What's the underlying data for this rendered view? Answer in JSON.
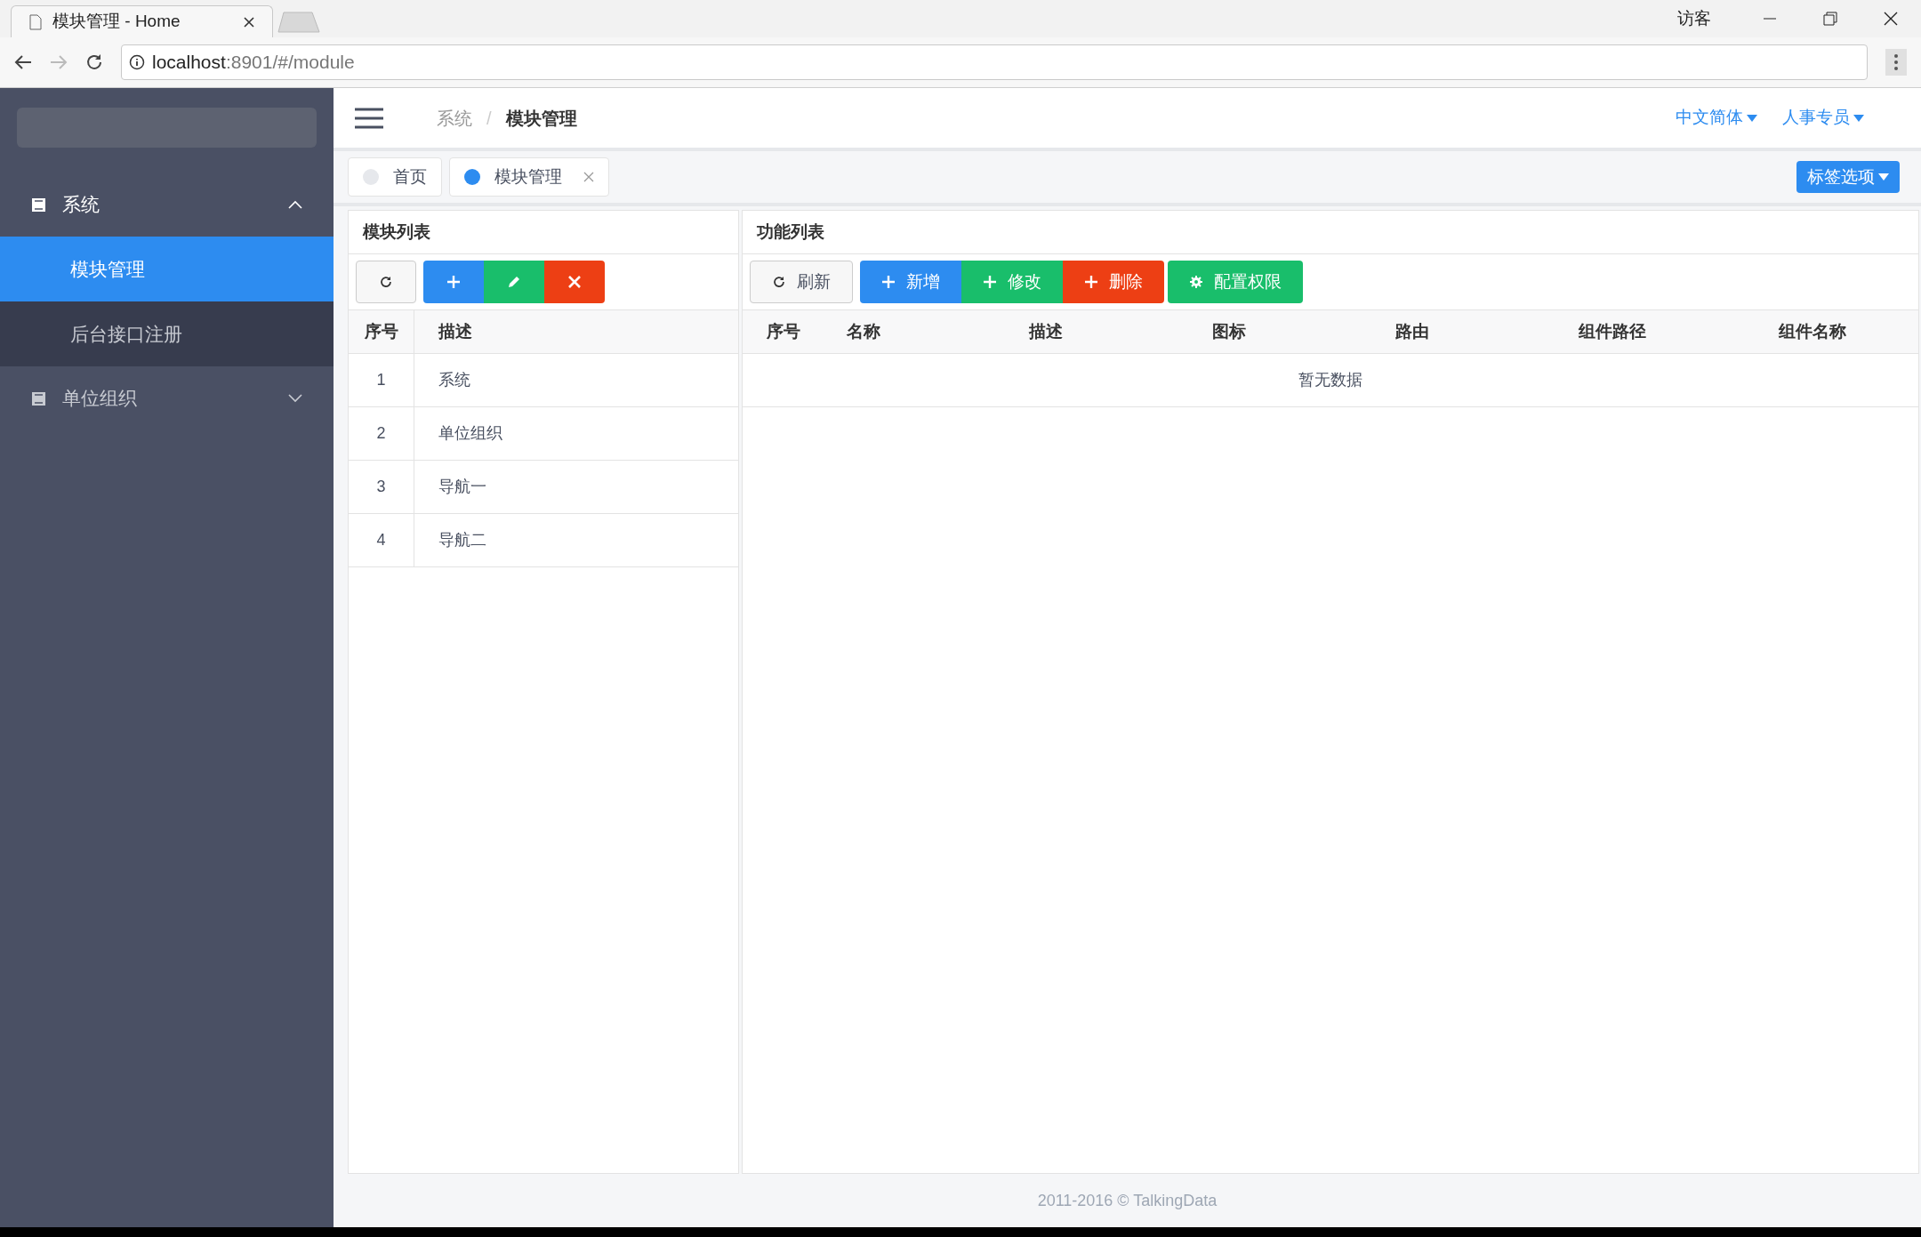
{
  "browser": {
    "tab_title": "模块管理 - Home",
    "url_host": "localhost",
    "url_rest": ":8901/#/module",
    "profile": "访客"
  },
  "sidebar": {
    "items": [
      {
        "label": "系统",
        "expanded": true,
        "children": [
          {
            "label": "模块管理",
            "selected": true
          },
          {
            "label": "后台接口注册",
            "selected": false
          }
        ]
      },
      {
        "label": "单位组织",
        "expanded": false
      }
    ]
  },
  "header": {
    "breadcrumb": [
      "系统",
      "模块管理"
    ],
    "separator": "/",
    "menus": [
      "中文简体",
      "人事专员"
    ]
  },
  "tabs": [
    {
      "label": "首页",
      "selected": false,
      "closable": false
    },
    {
      "label": "模块管理",
      "selected": true,
      "closable": true
    }
  ],
  "tab_options": "标签选项",
  "module_panel": {
    "title": "模块列表",
    "toolbar": [
      {
        "kind": "refresh"
      },
      {
        "kind": "add"
      },
      {
        "kind": "edit"
      },
      {
        "kind": "delete"
      }
    ],
    "columns": [
      "序号",
      "描述"
    ],
    "rows": [
      {
        "index": "1",
        "description": "系统"
      },
      {
        "index": "2",
        "description": "单位组织"
      },
      {
        "index": "3",
        "description": "导航一"
      },
      {
        "index": "4",
        "description": "导航二"
      }
    ]
  },
  "function_panel": {
    "title": "功能列表",
    "toolbar": [
      {
        "kind": "refresh",
        "label": "刷新"
      },
      {
        "kind": "add",
        "label": "新增"
      },
      {
        "kind": "edit",
        "label": "修改"
      },
      {
        "kind": "delete",
        "label": "删除"
      },
      {
        "kind": "permission",
        "label": "配置权限"
      }
    ],
    "columns": [
      "序号",
      "名称",
      "描述",
      "图标",
      "路由",
      "组件路径",
      "组件名称"
    ],
    "empty_text": "暂无数据"
  },
  "footer": "2011-2016 © TalkingData"
}
